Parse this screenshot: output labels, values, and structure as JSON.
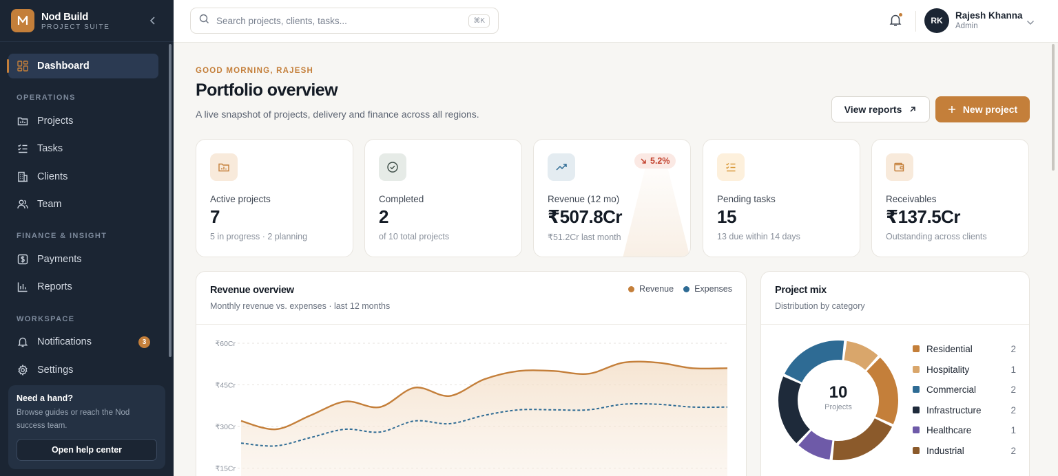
{
  "brand": {
    "name": "Nod Build",
    "sub": "PROJECT SUITE",
    "logo_letter": "N"
  },
  "nav": {
    "dashboard": "Dashboard",
    "sections": {
      "operations": "OPERATIONS",
      "finance": "FINANCE & INSIGHT",
      "workspace": "WORKSPACE"
    },
    "projects": "Projects",
    "tasks": "Tasks",
    "clients": "Clients",
    "team": "Team",
    "payments": "Payments",
    "reports": "Reports",
    "notifications": "Notifications",
    "notifications_badge": "3",
    "settings": "Settings"
  },
  "help": {
    "title": "Need a hand?",
    "text": "Browse guides or reach the Nod success team.",
    "button": "Open help center"
  },
  "search": {
    "placeholder": "Search projects, clients, tasks...",
    "shortcut": "⌘K"
  },
  "user": {
    "initials": "RK",
    "name": "Rajesh Khanna",
    "role": "Admin"
  },
  "header": {
    "greeting": "GOOD MORNING, RAJESH",
    "title": "Portfolio overview",
    "subtitle": "A live snapshot of projects, delivery and finance across all regions.",
    "view_reports": "View reports",
    "new_project": "New project"
  },
  "stats": [
    {
      "label": "Active projects",
      "value": "7",
      "note": "5 in progress · 2 planning",
      "icon": "folder-chart-icon"
    },
    {
      "label": "Completed",
      "value": "2",
      "note": "of 10 total projects",
      "icon": "check-circle-icon"
    },
    {
      "label": "Revenue (12 mo)",
      "value": "₹507.8Cr",
      "note": "₹51.2Cr last month",
      "icon": "trend-up-icon",
      "badge": "5.2%"
    },
    {
      "label": "Pending tasks",
      "value": "15",
      "note": "13 due within 14 days",
      "icon": "checklist-icon"
    },
    {
      "label": "Receivables",
      "value": "₹137.5Cr",
      "note": "Outstanding across clients",
      "icon": "wallet-icon"
    }
  ],
  "colors": {
    "accent": "#c47f3a",
    "revenue": "#c47f3a",
    "expenses": "#2e6b94",
    "sidebar": "#1b2533"
  },
  "revenue_chart": {
    "title": "Revenue overview",
    "subtitle": "Monthly revenue vs. expenses · last 12 months",
    "legend": [
      "Revenue",
      "Expenses"
    ]
  },
  "chart_data": {
    "type": "area",
    "y_ticks": [
      "₹60Cr",
      "₹45Cr",
      "₹30Cr",
      "₹15Cr"
    ],
    "y_tick_values": [
      60,
      45,
      30,
      15
    ],
    "ylim": [
      10,
      60
    ],
    "x": [
      1,
      2,
      3,
      4,
      5,
      6,
      7,
      8,
      9,
      10,
      11,
      12,
      13,
      14,
      15
    ],
    "series": [
      {
        "name": "Revenue",
        "values": [
          32,
          29,
          34,
          39,
          37,
          44,
          41,
          47,
          50,
          50,
          49,
          53,
          53,
          51,
          51
        ]
      },
      {
        "name": "Expenses",
        "values": [
          24,
          23,
          26,
          29,
          28,
          32,
          31,
          34,
          36,
          36,
          36,
          38,
          38,
          37,
          37
        ]
      }
    ],
    "grid": true,
    "legend_position": "top-right"
  },
  "project_mix": {
    "title": "Project mix",
    "subtitle": "Distribution by category",
    "total": "10",
    "total_label": "Projects",
    "items": [
      {
        "name": "Residential",
        "count": 2,
        "color": "#c47f3a"
      },
      {
        "name": "Hospitality",
        "count": 1,
        "color": "#d9a66b"
      },
      {
        "name": "Commercial",
        "count": 2,
        "color": "#2e6b94"
      },
      {
        "name": "Infrastructure",
        "count": 2,
        "color": "#1e2a3a"
      },
      {
        "name": "Healthcare",
        "count": 1,
        "color": "#6e5aa8"
      },
      {
        "name": "Industrial",
        "count": 2,
        "color": "#8b5a2b"
      }
    ]
  }
}
